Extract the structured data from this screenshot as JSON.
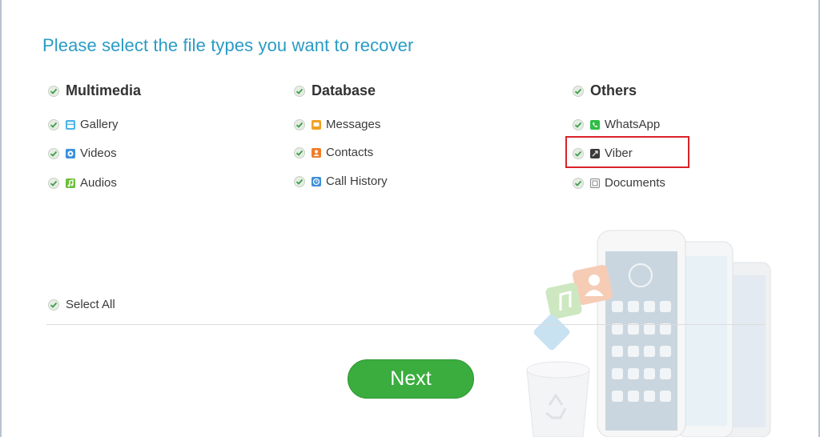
{
  "title": "Please select the file types you want to recover",
  "colors": {
    "title": "#2a9bc4",
    "check": "#3e9e4a",
    "next_button": "#3aad3e",
    "highlight_border": "#d9222a",
    "gallery_icon": "#4ab3e8",
    "videos_icon": "#3b8fdc",
    "audios_icon": "#6cbf3a",
    "messages_icon": "#f0a022",
    "contacts_icon": "#f07c2a",
    "callhistory_icon": "#3e8fd8",
    "whatsapp_icon": "#2fbd45",
    "viber_icon": "#3a3a3a",
    "documents_icon": "#8a8a8a"
  },
  "categories": [
    {
      "label": "Multimedia",
      "checked": true,
      "items": [
        {
          "label": "Gallery",
          "icon": "gallery-icon",
          "checked": true
        },
        {
          "label": "Videos",
          "icon": "videos-icon",
          "checked": true
        },
        {
          "label": "Audios",
          "icon": "audios-icon",
          "checked": true
        }
      ]
    },
    {
      "label": "Database",
      "checked": true,
      "items": [
        {
          "label": "Messages",
          "icon": "messages-icon",
          "checked": true
        },
        {
          "label": "Contacts",
          "icon": "contacts-icon",
          "checked": true
        },
        {
          "label": "Call History",
          "icon": "call-history-icon",
          "checked": true
        }
      ]
    },
    {
      "label": "Others",
      "checked": true,
      "items": [
        {
          "label": "WhatsApp",
          "icon": "whatsapp-icon",
          "checked": true
        },
        {
          "label": "Viber",
          "icon": "viber-icon",
          "checked": true
        },
        {
          "label": "Documents",
          "icon": "documents-icon",
          "checked": true
        }
      ]
    }
  ],
  "select_all": {
    "label": "Select All",
    "checked": true
  },
  "next_button": {
    "label": "Next"
  }
}
